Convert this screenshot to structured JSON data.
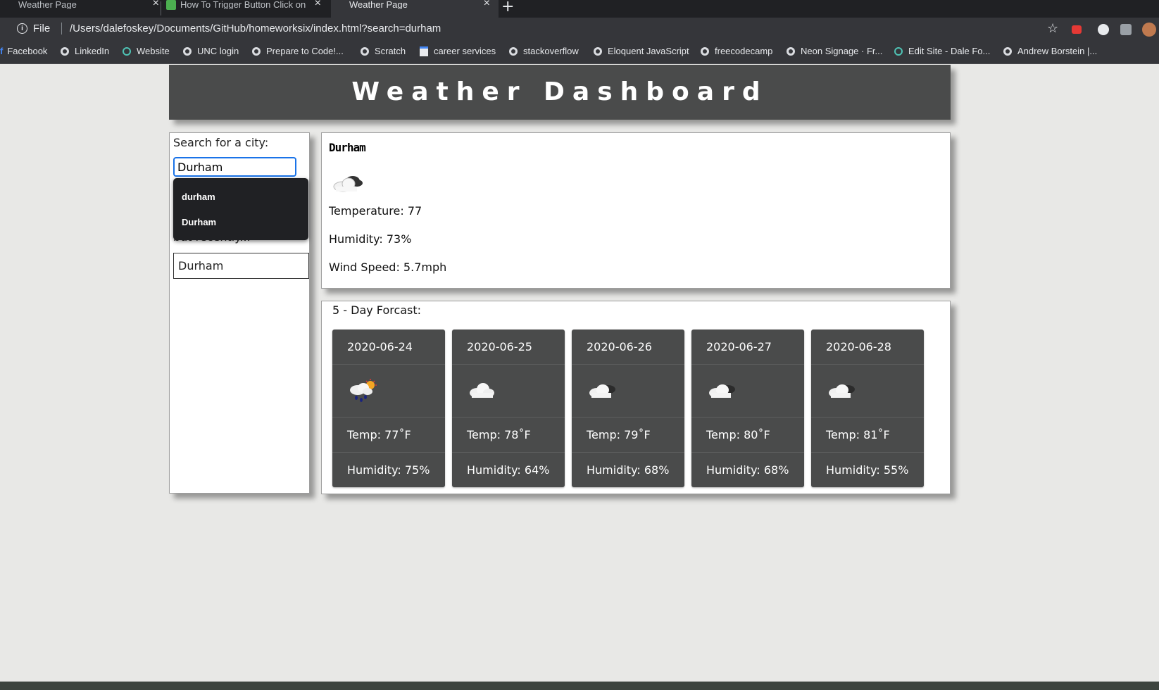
{
  "browser": {
    "tabs": [
      {
        "title": "Weather Page",
        "active": false
      },
      {
        "title": "How To Trigger Button Click on",
        "active": false
      },
      {
        "title": "Weather Page",
        "active": true
      }
    ],
    "omnibox": {
      "scheme_label": "File",
      "url": "/Users/dalefoskey/Documents/GitHub/homeworksix/index.html?search=durham"
    },
    "bookmarks": [
      {
        "label": "Facebook",
        "icon": "facebook-icon"
      },
      {
        "label": "LinkedIn",
        "icon": "globe-icon"
      },
      {
        "label": "Website",
        "icon": "swirl-icon"
      },
      {
        "label": "UNC login",
        "icon": "globe-icon"
      },
      {
        "label": "Prepare to Code!...",
        "icon": "globe-icon"
      },
      {
        "label": "Scratch",
        "icon": "globe-icon"
      },
      {
        "label": "career services",
        "icon": "page-icon"
      },
      {
        "label": "stackoverflow",
        "icon": "globe-icon"
      },
      {
        "label": "Eloquent JavaScript",
        "icon": "globe-icon"
      },
      {
        "label": "freecodecamp",
        "icon": "globe-icon"
      },
      {
        "label": "Neon Signage · Fr...",
        "icon": "globe-icon"
      },
      {
        "label": "Edit Site - Dale Fo...",
        "icon": "swirl-icon"
      },
      {
        "label": "Andrew Borstein |...",
        "icon": "globe-icon"
      }
    ]
  },
  "page": {
    "title": "Weather Dashboard",
    "search": {
      "label": "Search for a city:",
      "value": "Durham",
      "suggestions": [
        "durham",
        "Durham"
      ]
    },
    "recent": {
      "label": "but recently...",
      "items": [
        "Durham"
      ]
    },
    "current": {
      "city": "Durham",
      "icon": "cloud-icon",
      "temperature": "Temperature: 77",
      "humidity": "Humidity: 73%",
      "wind": "Wind Speed: 5.7mph"
    },
    "forecast": {
      "title": "5 - Day Forcast:",
      "days": [
        {
          "date": "2020-06-24",
          "icon": "rain-sun-icon",
          "temp": "Temp: 77˚F",
          "humidity": "Humidity: 75%"
        },
        {
          "date": "2020-06-25",
          "icon": "cloud-icon",
          "temp": "Temp: 78˚F",
          "humidity": "Humidity: 64%"
        },
        {
          "date": "2020-06-26",
          "icon": "cloud-icon",
          "temp": "Temp: 79˚F",
          "humidity": "Humidity: 68%"
        },
        {
          "date": "2020-06-27",
          "icon": "cloud-icon",
          "temp": "Temp: 80˚F",
          "humidity": "Humidity: 68%"
        },
        {
          "date": "2020-06-28",
          "icon": "cloud-icon",
          "temp": "Temp: 81˚F",
          "humidity": "Humidity: 55%"
        }
      ]
    }
  },
  "colors": {
    "header_bg": "#4a4b4b",
    "card_bg": "#4a4b4b",
    "page_bg": "#e8e8e6",
    "focus_ring": "#1a73e8"
  }
}
